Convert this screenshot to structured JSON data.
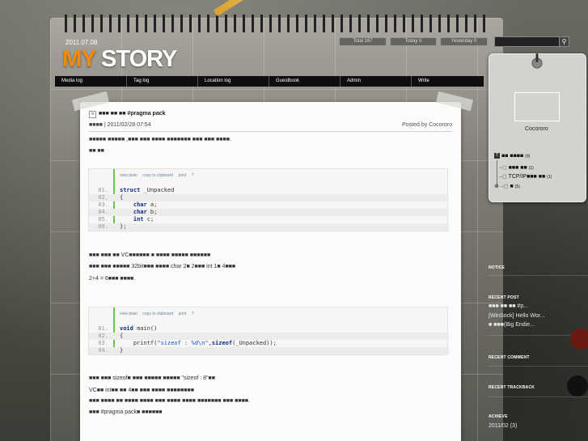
{
  "header": {
    "date": "2011.07.08",
    "logo_my": "MY",
    "logo_story": " STORY",
    "stats": {
      "total": "Total 167",
      "today": "Today 0",
      "yesterday": "Yesterday 0"
    }
  },
  "menu": {
    "items": [
      "Media log",
      "Tag log",
      "Location log",
      "Guestbook",
      "Admin",
      "Write"
    ]
  },
  "post": {
    "title": "■■■ ■■ ■■ #pragma pack",
    "meta": "■■■■ | 2011/02/28 07:54",
    "posted_by": "Posted by Cocororo",
    "para1_line1": "■■■■■ ■■■■■ ,■■■ ■■■ ■■■■ ■■■■■■■ ■■■ ■■■ ■■■■.",
    "para1_line2": "■■ ■■",
    "para2_line1": "■■■ ■■■ ■■ VC■■■■■■ ■ ■■■■ ■■■■■ ■■■■■■",
    "para2_line2": "■■■ ■■■ ■■■■■ 32bit■■■ ■■■■ char 2■ 2■■■ int 1■ 4■■■",
    "para2_line3": "2+4 = 6■■■ ■■■■.",
    "para3_line1": "■■■ ■■■ sizeof■ ■■■ ■■■■■ ■■■■■ \"sizeof : 8\"■■",
    "para3_line2": "VC■■ int■■ ■■ 4■■ ■■■ ■■■■ ■■■■■■■■",
    "para3_line3": "■■■ ■■■■ ■■ ■■■■ ■■■■ ■■■ ■■■■ ■■■■ ■■■■■■■ ■■■ ■■■■.",
    "para4_line1": "■■■ #pragma pack■ ■■■■■■"
  },
  "code_tools": [
    "view plain",
    "copy to clipboard",
    "print",
    "?"
  ],
  "code1": [
    {
      "n": "01.",
      "text": "struct _Unpacked"
    },
    {
      "n": "02.",
      "text": "{"
    },
    {
      "n": "03.",
      "text": "    char a;"
    },
    {
      "n": "04.",
      "text": "    char b;"
    },
    {
      "n": "05.",
      "text": "    int c;"
    },
    {
      "n": "06.",
      "text": "};"
    }
  ],
  "code2": [
    {
      "n": "01.",
      "text": "void main()"
    },
    {
      "n": "02.",
      "text": "{"
    },
    {
      "n": "03.",
      "text": "    printf(\"sizeof : %d\\n\",sizeof(_Unpacked));"
    },
    {
      "n": "04.",
      "text": "}"
    }
  ],
  "sidebar": {
    "nickname": "Cocororo",
    "categories": [
      {
        "label": "■■ ■■■■",
        "count": "(9)"
      },
      {
        "label": "■■■ ■■",
        "count": "(1)"
      },
      {
        "label": "TCP/IP■■■ ■■",
        "count": "(1)"
      },
      {
        "label": "■",
        "count": "(5)"
      }
    ],
    "notice_head": "NOTICE",
    "recent_post_head": "RECENT POST",
    "recent_posts": [
      "■■■ ■■ ■■ #p...",
      "[WinSock] Hello Wor...",
      "■ ■■■(Big Endie..."
    ],
    "recent_comment_head": "RECENT COMMENT",
    "recent_trackback_head": "RECENT TRACKBACK",
    "achieve_head": "ACHIEVE",
    "achieve_items": [
      "2011/02 (3)"
    ],
    "accent": "#f08a10"
  }
}
